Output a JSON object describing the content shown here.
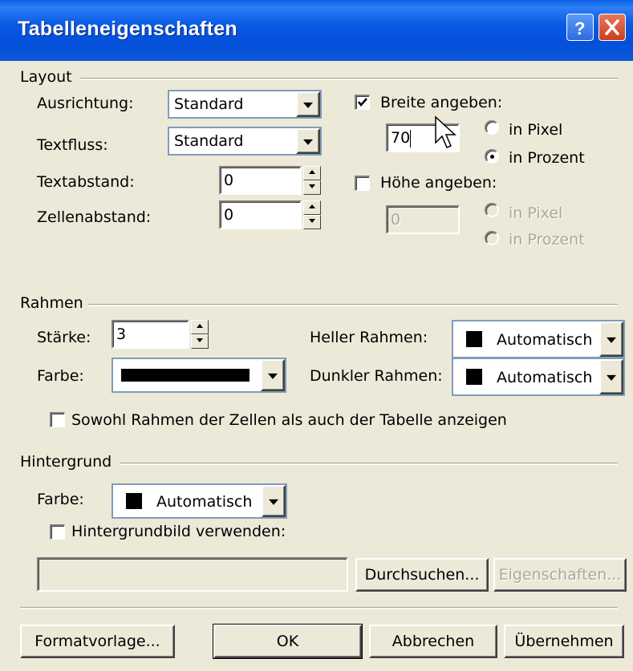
{
  "window": {
    "title": "Tabelleneigenschaften",
    "help_icon": "?",
    "close_icon": "close-x"
  },
  "layout": {
    "group_label": "Layout",
    "ausrichtung": {
      "label": "Ausrichtung:",
      "value": "Standard"
    },
    "textfluss": {
      "label": "Textfluss:",
      "value": "Standard"
    },
    "textabstand": {
      "label": "Textabstand:",
      "value": "0"
    },
    "zellenabstand": {
      "label": "Zellenabstand:",
      "value": "0"
    },
    "breite": {
      "checkbox_label": "Breite angeben:",
      "checked": true,
      "value": "70",
      "pixel_label": "in Pixel",
      "prozent_label": "in Prozent",
      "selected": "prozent"
    },
    "hoehe": {
      "checkbox_label": "Höhe angeben:",
      "checked": false,
      "value": "0",
      "pixel_label": "in Pixel",
      "prozent_label": "in Prozent"
    }
  },
  "rahmen": {
    "group_label": "Rahmen",
    "staerke": {
      "label": "Stärke:",
      "value": "3"
    },
    "farbe": {
      "label": "Farbe:",
      "color": "#000000"
    },
    "heller": {
      "label": "Heller Rahmen:",
      "value": "Automatisch",
      "color": "#000000"
    },
    "dunkler": {
      "label": "Dunkler Rahmen:",
      "value": "Automatisch",
      "color": "#000000"
    },
    "sowohl_label": "Sowohl Rahmen der Zellen als auch der Tabelle anzeigen"
  },
  "hintergrund": {
    "group_label": "Hintergrund",
    "farbe": {
      "label": "Farbe:",
      "value": "Automatisch",
      "color": "#000000"
    },
    "bild_label": "Hintergrundbild verwenden:",
    "path_value": "",
    "durchsuchen": "Durchsuchen...",
    "eigenschaften": "Eigenschaften..."
  },
  "footer": {
    "formatvorlage": "Formatvorlage...",
    "ok": "OK",
    "abbrechen": "Abbrechen",
    "uebernehmen": "Übernehmen"
  },
  "colors": {
    "titlebar": "#0A5FE6",
    "dialog_bg": "#ECE9D8",
    "field_border": "#7F9DB9"
  }
}
